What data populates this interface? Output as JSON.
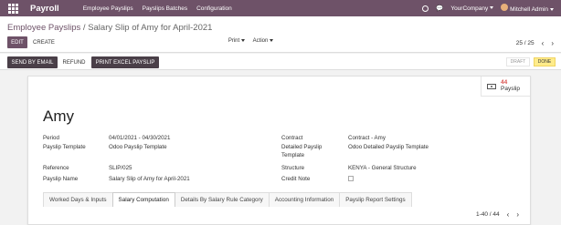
{
  "topbar": {
    "brand": "Payroll",
    "menu": [
      "Employee Payslips",
      "Payslips Batches",
      "Configuration"
    ],
    "company": "YourCompany",
    "user": "Mitchell Admin"
  },
  "control": {
    "breadcrumb_parent": "Employee Payslips",
    "breadcrumb_sep": "/",
    "breadcrumb_current": "Salary Slip of Amy for April-2021",
    "edit": "EDIT",
    "create": "CREATE",
    "print": "Print",
    "action": "Action",
    "pager": "25 / 25"
  },
  "status": {
    "send_email": "SEND BY EMAIL",
    "refund": "REFUND",
    "print_excel": "PRINT EXCEL PAYSLIP",
    "stage_draft": "DRAFT",
    "stage_done": "DONE"
  },
  "sheet": {
    "smart_count": "44",
    "smart_label": "Payslip",
    "employee": "Amy",
    "period_label": "Period",
    "period_value": "04/01/2021 - 04/30/2021",
    "template_label": "Payslip Template",
    "template_value": "Odoo Payslip Template",
    "reference_label": "Reference",
    "reference_value": "SLIP/025",
    "payslip_name_label": "Payslip Name",
    "payslip_name_value": "Salary Slip of Amy for April-2021",
    "contract_label": "Contract",
    "contract_value": "Contract - Amy",
    "detailed_label_1": "Detailed Payslip",
    "detailed_label_2": "Template",
    "detailed_value": "Odoo Detailed Payslip Template",
    "structure_label": "Structure",
    "structure_value": "KENYA - General Structure",
    "credit_note_label": "Credit Note",
    "tabs": [
      "Worked Days & Inputs",
      "Salary Computation",
      "Details By Salary Rule Category",
      "Accounting Information",
      "Payslip Report Settings"
    ],
    "lines_pager": "1-40 / 44"
  }
}
